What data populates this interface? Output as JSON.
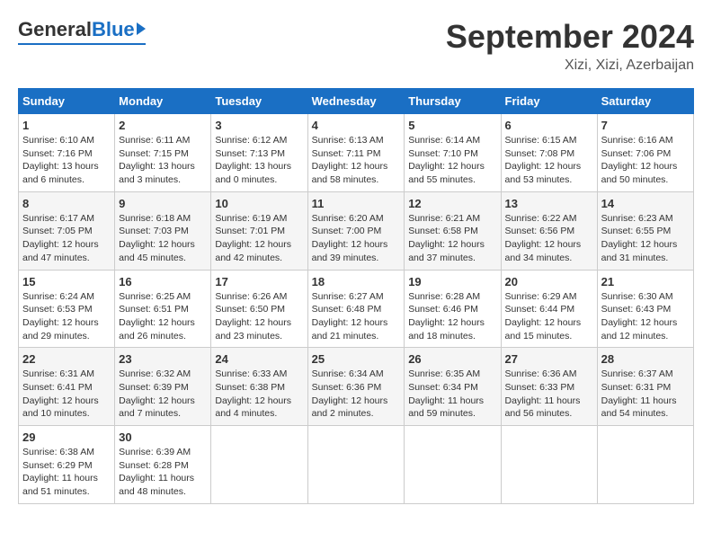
{
  "header": {
    "logo_general": "General",
    "logo_blue": "Blue",
    "month_title": "September 2024",
    "location": "Xizi, Xizi, Azerbaijan"
  },
  "weekdays": [
    "Sunday",
    "Monday",
    "Tuesday",
    "Wednesday",
    "Thursday",
    "Friday",
    "Saturday"
  ],
  "weeks": [
    [
      {
        "day": "1",
        "info": "Sunrise: 6:10 AM\nSunset: 7:16 PM\nDaylight: 13 hours\nand 6 minutes."
      },
      {
        "day": "2",
        "info": "Sunrise: 6:11 AM\nSunset: 7:15 PM\nDaylight: 13 hours\nand 3 minutes."
      },
      {
        "day": "3",
        "info": "Sunrise: 6:12 AM\nSunset: 7:13 PM\nDaylight: 13 hours\nand 0 minutes."
      },
      {
        "day": "4",
        "info": "Sunrise: 6:13 AM\nSunset: 7:11 PM\nDaylight: 12 hours\nand 58 minutes."
      },
      {
        "day": "5",
        "info": "Sunrise: 6:14 AM\nSunset: 7:10 PM\nDaylight: 12 hours\nand 55 minutes."
      },
      {
        "day": "6",
        "info": "Sunrise: 6:15 AM\nSunset: 7:08 PM\nDaylight: 12 hours\nand 53 minutes."
      },
      {
        "day": "7",
        "info": "Sunrise: 6:16 AM\nSunset: 7:06 PM\nDaylight: 12 hours\nand 50 minutes."
      }
    ],
    [
      {
        "day": "8",
        "info": "Sunrise: 6:17 AM\nSunset: 7:05 PM\nDaylight: 12 hours\nand 47 minutes."
      },
      {
        "day": "9",
        "info": "Sunrise: 6:18 AM\nSunset: 7:03 PM\nDaylight: 12 hours\nand 45 minutes."
      },
      {
        "day": "10",
        "info": "Sunrise: 6:19 AM\nSunset: 7:01 PM\nDaylight: 12 hours\nand 42 minutes."
      },
      {
        "day": "11",
        "info": "Sunrise: 6:20 AM\nSunset: 7:00 PM\nDaylight: 12 hours\nand 39 minutes."
      },
      {
        "day": "12",
        "info": "Sunrise: 6:21 AM\nSunset: 6:58 PM\nDaylight: 12 hours\nand 37 minutes."
      },
      {
        "day": "13",
        "info": "Sunrise: 6:22 AM\nSunset: 6:56 PM\nDaylight: 12 hours\nand 34 minutes."
      },
      {
        "day": "14",
        "info": "Sunrise: 6:23 AM\nSunset: 6:55 PM\nDaylight: 12 hours\nand 31 minutes."
      }
    ],
    [
      {
        "day": "15",
        "info": "Sunrise: 6:24 AM\nSunset: 6:53 PM\nDaylight: 12 hours\nand 29 minutes."
      },
      {
        "day": "16",
        "info": "Sunrise: 6:25 AM\nSunset: 6:51 PM\nDaylight: 12 hours\nand 26 minutes."
      },
      {
        "day": "17",
        "info": "Sunrise: 6:26 AM\nSunset: 6:50 PM\nDaylight: 12 hours\nand 23 minutes."
      },
      {
        "day": "18",
        "info": "Sunrise: 6:27 AM\nSunset: 6:48 PM\nDaylight: 12 hours\nand 21 minutes."
      },
      {
        "day": "19",
        "info": "Sunrise: 6:28 AM\nSunset: 6:46 PM\nDaylight: 12 hours\nand 18 minutes."
      },
      {
        "day": "20",
        "info": "Sunrise: 6:29 AM\nSunset: 6:44 PM\nDaylight: 12 hours\nand 15 minutes."
      },
      {
        "day": "21",
        "info": "Sunrise: 6:30 AM\nSunset: 6:43 PM\nDaylight: 12 hours\nand 12 minutes."
      }
    ],
    [
      {
        "day": "22",
        "info": "Sunrise: 6:31 AM\nSunset: 6:41 PM\nDaylight: 12 hours\nand 10 minutes."
      },
      {
        "day": "23",
        "info": "Sunrise: 6:32 AM\nSunset: 6:39 PM\nDaylight: 12 hours\nand 7 minutes."
      },
      {
        "day": "24",
        "info": "Sunrise: 6:33 AM\nSunset: 6:38 PM\nDaylight: 12 hours\nand 4 minutes."
      },
      {
        "day": "25",
        "info": "Sunrise: 6:34 AM\nSunset: 6:36 PM\nDaylight: 12 hours\nand 2 minutes."
      },
      {
        "day": "26",
        "info": "Sunrise: 6:35 AM\nSunset: 6:34 PM\nDaylight: 11 hours\nand 59 minutes."
      },
      {
        "day": "27",
        "info": "Sunrise: 6:36 AM\nSunset: 6:33 PM\nDaylight: 11 hours\nand 56 minutes."
      },
      {
        "day": "28",
        "info": "Sunrise: 6:37 AM\nSunset: 6:31 PM\nDaylight: 11 hours\nand 54 minutes."
      }
    ],
    [
      {
        "day": "29",
        "info": "Sunrise: 6:38 AM\nSunset: 6:29 PM\nDaylight: 11 hours\nand 51 minutes."
      },
      {
        "day": "30",
        "info": "Sunrise: 6:39 AM\nSunset: 6:28 PM\nDaylight: 11 hours\nand 48 minutes."
      },
      {
        "day": "",
        "info": ""
      },
      {
        "day": "",
        "info": ""
      },
      {
        "day": "",
        "info": ""
      },
      {
        "day": "",
        "info": ""
      },
      {
        "day": "",
        "info": ""
      }
    ]
  ]
}
